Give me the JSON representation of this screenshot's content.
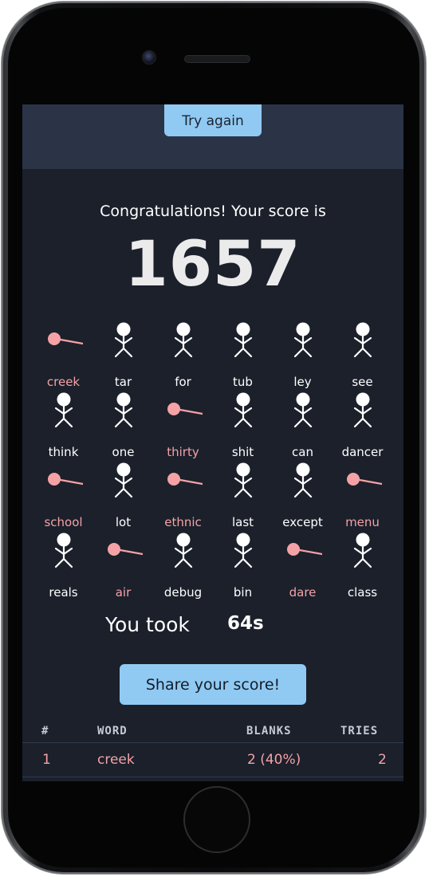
{
  "header": {
    "try_again_label": "Try again"
  },
  "result": {
    "congrats_text": "Congratulations! Your score is",
    "score": "1657",
    "took_label": "You took",
    "took_value": "64s"
  },
  "words": [
    {
      "word": "creek",
      "status": "lost"
    },
    {
      "word": "tar",
      "status": "won"
    },
    {
      "word": "for",
      "status": "won"
    },
    {
      "word": "tub",
      "status": "won"
    },
    {
      "word": "ley",
      "status": "won"
    },
    {
      "word": "see",
      "status": "won"
    },
    {
      "word": "think",
      "status": "won"
    },
    {
      "word": "one",
      "status": "won"
    },
    {
      "word": "thirty",
      "status": "lost"
    },
    {
      "word": "shit",
      "status": "won"
    },
    {
      "word": "can",
      "status": "won"
    },
    {
      "word": "dancer",
      "status": "won"
    },
    {
      "word": "school",
      "status": "lost"
    },
    {
      "word": "lot",
      "status": "won"
    },
    {
      "word": "ethnic",
      "status": "lost"
    },
    {
      "word": "last",
      "status": "won"
    },
    {
      "word": "except",
      "status": "won"
    },
    {
      "word": "menu",
      "status": "lost"
    },
    {
      "word": "reals",
      "status": "won"
    },
    {
      "word": "air",
      "status": "lost"
    },
    {
      "word": "debug",
      "status": "won"
    },
    {
      "word": "bin",
      "status": "won"
    },
    {
      "word": "dare",
      "status": "lost"
    },
    {
      "word": "class",
      "status": "won"
    }
  ],
  "share": {
    "label": "Share your score!"
  },
  "table": {
    "headers": [
      "#",
      "WORD",
      "BLANKS",
      "TRIES"
    ],
    "rows": [
      {
        "num": "1",
        "word": "creek",
        "blanks": "2 (40%)",
        "tries": "2"
      }
    ]
  },
  "colors": {
    "accent": "#90caf3",
    "lost": "#f4a2a6",
    "background": "#1b202b",
    "topbar": "#2b3446"
  },
  "icons": {
    "won": "stick-figure-icon",
    "lost": "fallen-stick-figure-icon"
  }
}
